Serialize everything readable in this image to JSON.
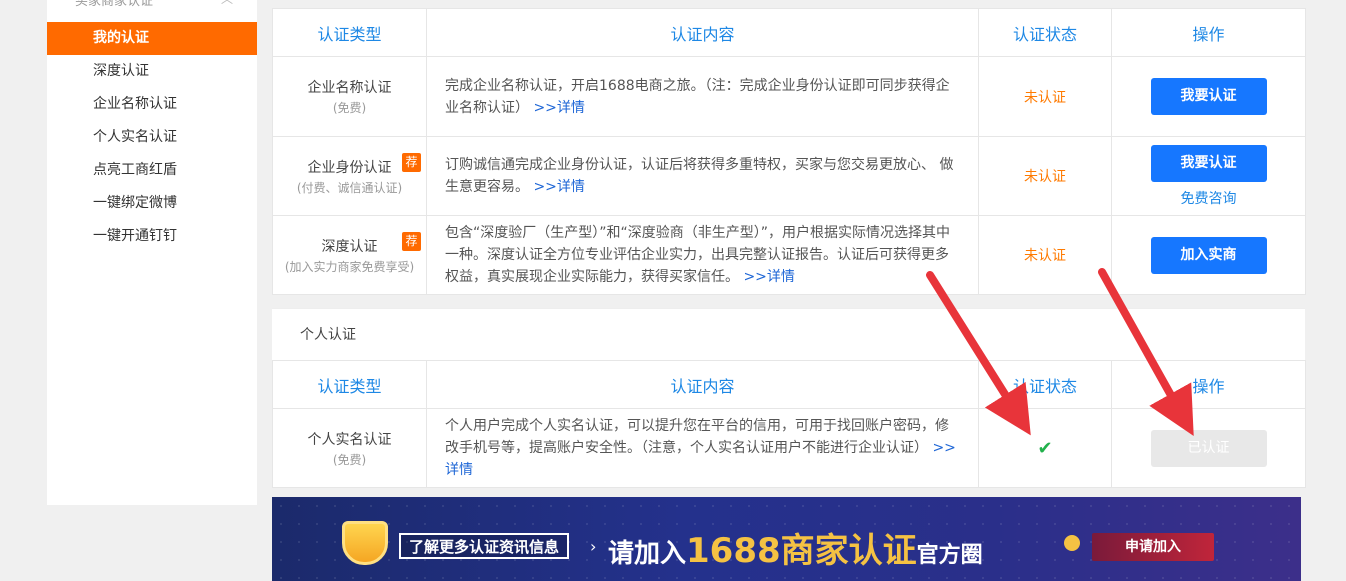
{
  "sidebar": {
    "section_title": "买家商家认证",
    "items": [
      {
        "label": "我的认证",
        "active": true
      },
      {
        "label": "深度认证"
      },
      {
        "label": "企业名称认证"
      },
      {
        "label": "个人实名认证"
      },
      {
        "label": "点亮工商红盾"
      },
      {
        "label": "一键绑定微博"
      },
      {
        "label": "一键开通钉钉"
      }
    ]
  },
  "headers": {
    "type": "认证类型",
    "content": "认证内容",
    "status": "认证状态",
    "op": "操作"
  },
  "enterprise_rows": [
    {
      "type": "企业名称认证",
      "sub": "(免费)",
      "desc": "完成企业名称认证，开启1688电商之旅。（注：完成企业身份认证即可同步获得企业名称认证）",
      "more": ">>详情",
      "status": "未认证",
      "button": "我要认证"
    },
    {
      "type": "企业身份认证",
      "badge": "荐",
      "sub": "(付费、诚信通认证)",
      "desc": "订购诚信通完成企业身份认证，认证后将获得多重特权，买家与您交易更放心、 做生意更容易。",
      "more": ">>详情",
      "status": "未认证",
      "button": "我要认证",
      "link": "免费咨询"
    },
    {
      "type": "深度认证",
      "badge": "荐",
      "sub": "(加入实力商家免费享受)",
      "desc": "包含“深度验厂（生产型）”和“深度验商（非生产型）”，用户根据实际情况选择其中一种。深度认证全方位专业评估企业实力，出具完整认证报告。认证后可获得更多权益，真实展现企业实际能力，获得买家信任。",
      "more": ">>详情",
      "status": "未认证",
      "button": "加入实商"
    }
  ],
  "personal": {
    "title": "个人认证",
    "row": {
      "type": "个人实名认证",
      "sub": "(免费)",
      "desc": "个人用户完成个人实名认证，可以提升您在平台的信用，可用于找回账户密码，修改手机号等，提高账户安全性。（注意，个人实名认证用户不能进行企业认证）",
      "more": ">>详情",
      "status_icon": "✔",
      "button": "已认证"
    }
  },
  "banner": {
    "tag": "了解更多认证资讯信息",
    "pre": "请加入",
    "big": "1688商家认证",
    "post": "官方圈",
    "apply": "申请加入"
  },
  "colors": {
    "accent": "#ff6a00",
    "blue": "#1677ff",
    "arrow": "#e8343a"
  }
}
